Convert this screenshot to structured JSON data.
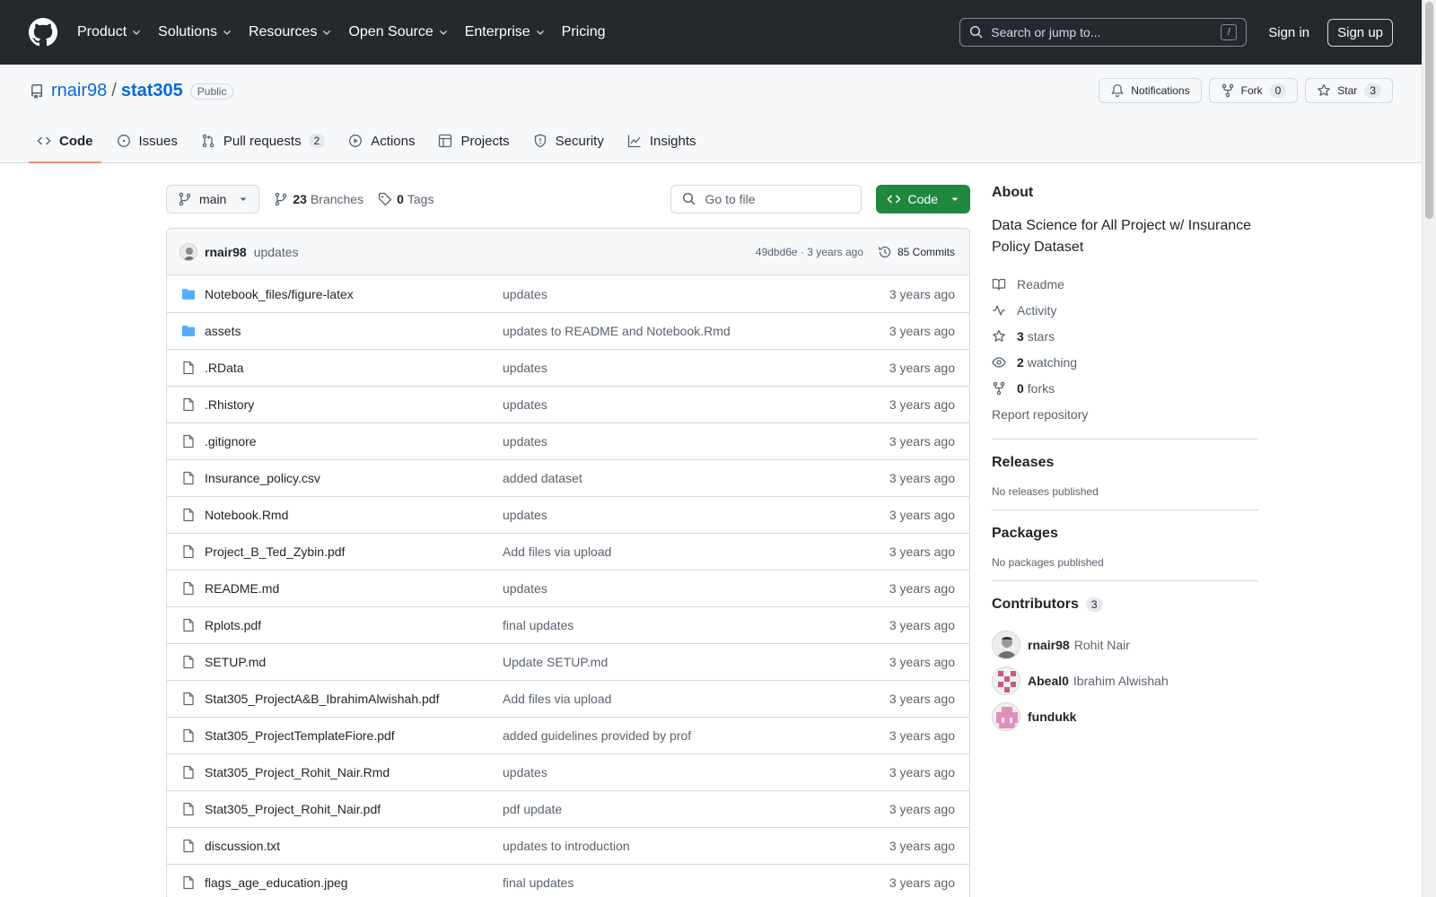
{
  "colors": {
    "header_bg": "#25292e",
    "link": "#0969da",
    "green": "#1f883d",
    "tab_underline": "#fd8c73",
    "folder": "#54aeff"
  },
  "header": {
    "nav": [
      "Product",
      "Solutions",
      "Resources",
      "Open Source",
      "Enterprise"
    ],
    "pricing": "Pricing",
    "search_placeholder": "Search or jump to...",
    "search_key": "/",
    "signin": "Sign in",
    "signup": "Sign up"
  },
  "repo": {
    "owner": "rnair98",
    "name": "stat305",
    "visibility": "Public",
    "notifications": "Notifications",
    "fork_label": "Fork",
    "fork_count": "0",
    "star_label": "Star",
    "star_count": "3"
  },
  "tabs": [
    {
      "label": "Code",
      "icon": "code-icon"
    },
    {
      "label": "Issues",
      "icon": "issue-icon"
    },
    {
      "label": "Pull requests",
      "icon": "pull-request-icon",
      "count": "2"
    },
    {
      "label": "Actions",
      "icon": "play-icon"
    },
    {
      "label": "Projects",
      "icon": "table-icon"
    },
    {
      "label": "Security",
      "icon": "shield-icon"
    },
    {
      "label": "Insights",
      "icon": "graph-icon"
    }
  ],
  "toolbar": {
    "branch": "main",
    "branches_count": "23",
    "branches_label": "Branches",
    "tags_count": "0",
    "tags_label": "Tags",
    "goto_placeholder": "Go to file",
    "code_button": "Code"
  },
  "latest_commit": {
    "author": "rnair98",
    "message": "updates",
    "hash_time": "49dbd6e · 3 years ago",
    "commits": "85 Commits"
  },
  "files": [
    {
      "name": "Notebook_files/figure-latex",
      "type": "folder",
      "message": "updates",
      "date": "3 years ago"
    },
    {
      "name": "assets",
      "type": "folder",
      "message": "updates to README and Notebook.Rmd",
      "date": "3 years ago"
    },
    {
      "name": ".RData",
      "type": "file",
      "message": "updates",
      "date": "3 years ago"
    },
    {
      "name": ".Rhistory",
      "type": "file",
      "message": "updates",
      "date": "3 years ago"
    },
    {
      "name": ".gitignore",
      "type": "file",
      "message": "updates",
      "date": "3 years ago"
    },
    {
      "name": "Insurance_policy.csv",
      "type": "file",
      "message": "added dataset",
      "date": "3 years ago"
    },
    {
      "name": "Notebook.Rmd",
      "type": "file",
      "message": "updates",
      "date": "3 years ago"
    },
    {
      "name": "Project_B_Ted_Zybin.pdf",
      "type": "file",
      "message": "Add files via upload",
      "date": "3 years ago"
    },
    {
      "name": "README.md",
      "type": "file",
      "message": "updates",
      "date": "3 years ago"
    },
    {
      "name": "Rplots.pdf",
      "type": "file",
      "message": "final updates",
      "date": "3 years ago"
    },
    {
      "name": "SETUP.md",
      "type": "file",
      "message": "Update SETUP.md",
      "date": "3 years ago"
    },
    {
      "name": "Stat305_ProjectA&B_IbrahimAlwishah.pdf",
      "type": "file",
      "message": "Add files via upload",
      "date": "3 years ago"
    },
    {
      "name": "Stat305_ProjectTemplateFiore.pdf",
      "type": "file",
      "message": "added guidelines provided by prof",
      "date": "3 years ago"
    },
    {
      "name": "Stat305_Project_Rohit_Nair.Rmd",
      "type": "file",
      "message": "updates",
      "date": "3 years ago"
    },
    {
      "name": "Stat305_Project_Rohit_Nair.pdf",
      "type": "file",
      "message": "pdf update",
      "date": "3 years ago"
    },
    {
      "name": "discussion.txt",
      "type": "file",
      "message": "updates to introduction",
      "date": "3 years ago"
    },
    {
      "name": "flags_age_education.jpeg",
      "type": "file",
      "message": "final updates",
      "date": "3 years ago"
    }
  ],
  "sidebar": {
    "about_title": "About",
    "description": "Data Science for All Project w/ Insurance Policy Dataset",
    "readme": "Readme",
    "activity": "Activity",
    "stars_count": "3",
    "stars_label": "stars",
    "watching_count": "2",
    "watching_label": "watching",
    "forks_count": "0",
    "forks_label": "forks",
    "report": "Report repository",
    "releases_title": "Releases",
    "releases_empty": "No releases published",
    "packages_title": "Packages",
    "packages_empty": "No packages published",
    "contributors_title": "Contributors",
    "contributors_count": "3",
    "contributors": [
      {
        "login": "rnair98",
        "name": "Rohit Nair"
      },
      {
        "login": "Abeal0",
        "name": "Ibrahim Alwishah"
      },
      {
        "login": "fundukk",
        "name": ""
      }
    ]
  }
}
